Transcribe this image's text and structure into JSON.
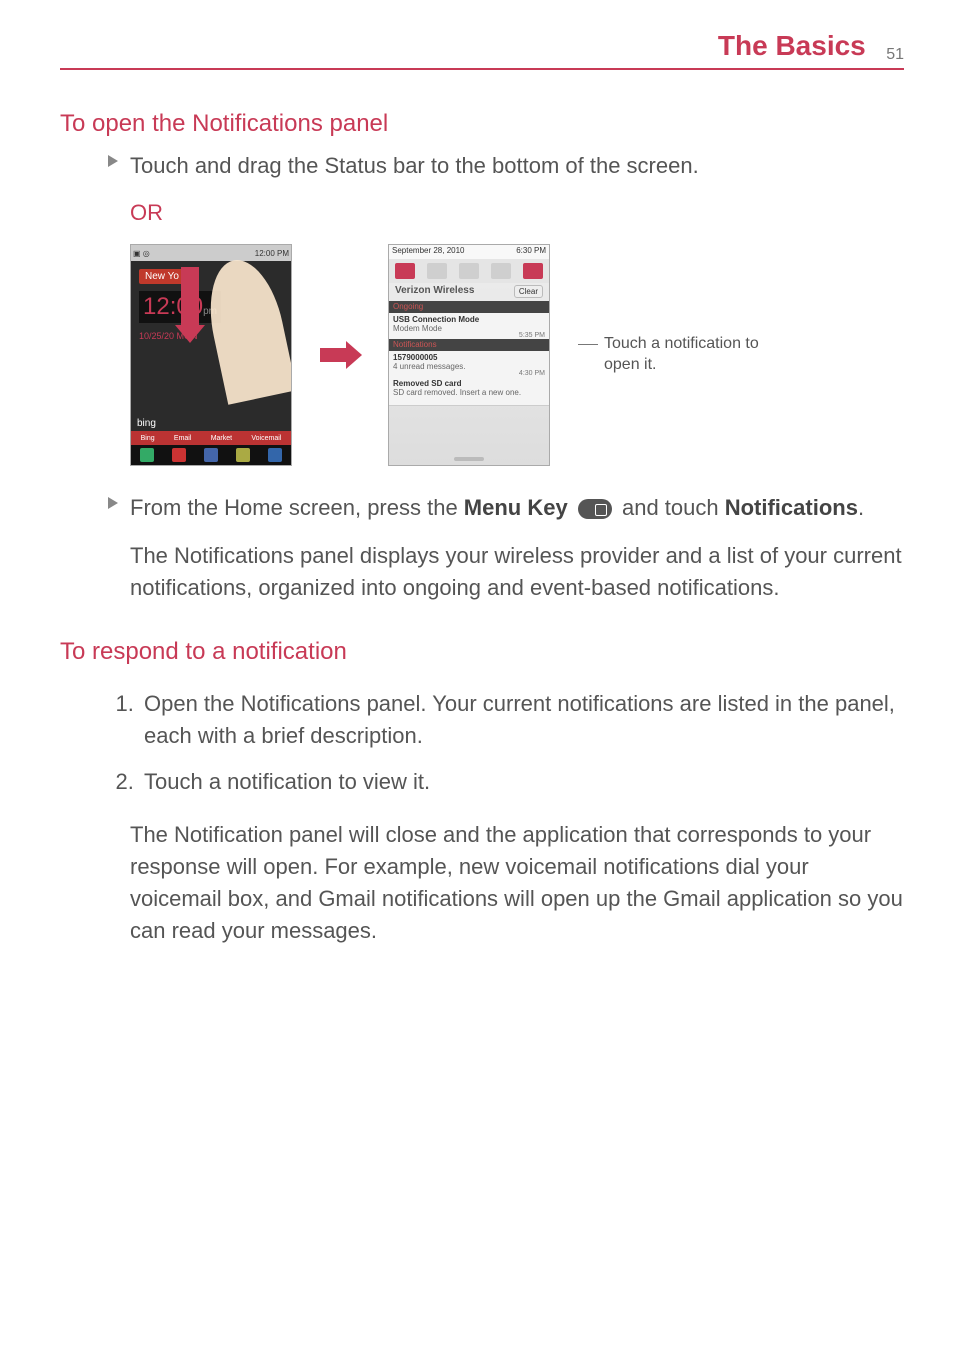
{
  "header": {
    "title": "The Basics",
    "page_number": "51"
  },
  "section1": {
    "heading": "To open the Notifications panel",
    "bullet1": "Touch and drag the Status bar to the bottom of the screen.",
    "or": "OR",
    "bullet2_pre": "From the Home screen, press the ",
    "bullet2_key": "Menu Key",
    "bullet2_post": " and touch ",
    "bullet2_target": "Notifications",
    "bullet2_period": ".",
    "para": "The Notifications panel displays your wireless provider and a list of your current notifications, organized into ongoing and event-based notifications."
  },
  "section2": {
    "heading": "To respond to a notification",
    "step1": "Open the Notifications panel. Your current notifications are listed in the panel, each with a brief description.",
    "step2": "Touch a notification to view it.",
    "para": "The Notification panel will close and the application that corresponds to your response will open. For example, new voicemail notifications dial your voicemail box, and Gmail notifications will open up the Gmail application so you can read your messages."
  },
  "figure": {
    "phone1": {
      "status_time": "12:00 PM",
      "city": "New Yo",
      "clock": "12:00",
      "clock_suffix": "pm",
      "date": "10/25/20   MON",
      "bing": "bing",
      "nav": [
        "Bing",
        "Email",
        "Market",
        "Voicemail"
      ]
    },
    "phone2": {
      "date": "September 28, 2010",
      "status_time": "6:30 PM",
      "carrier": "Verizon Wireless",
      "clear": "Clear",
      "ongoing_label": "Ongoing",
      "notifications_label": "Notifications",
      "item1_title": "USB Connection Mode",
      "item1_sub": "Modem Mode",
      "item1_time": "5:35 PM",
      "item2_title": "1579000005",
      "item2_sub": "4 unread messages.",
      "item2_time": "4:30 PM",
      "item3_title": "Removed SD card",
      "item3_sub": "SD card removed. Insert a new one."
    },
    "callout": "Touch a notification to open it."
  }
}
